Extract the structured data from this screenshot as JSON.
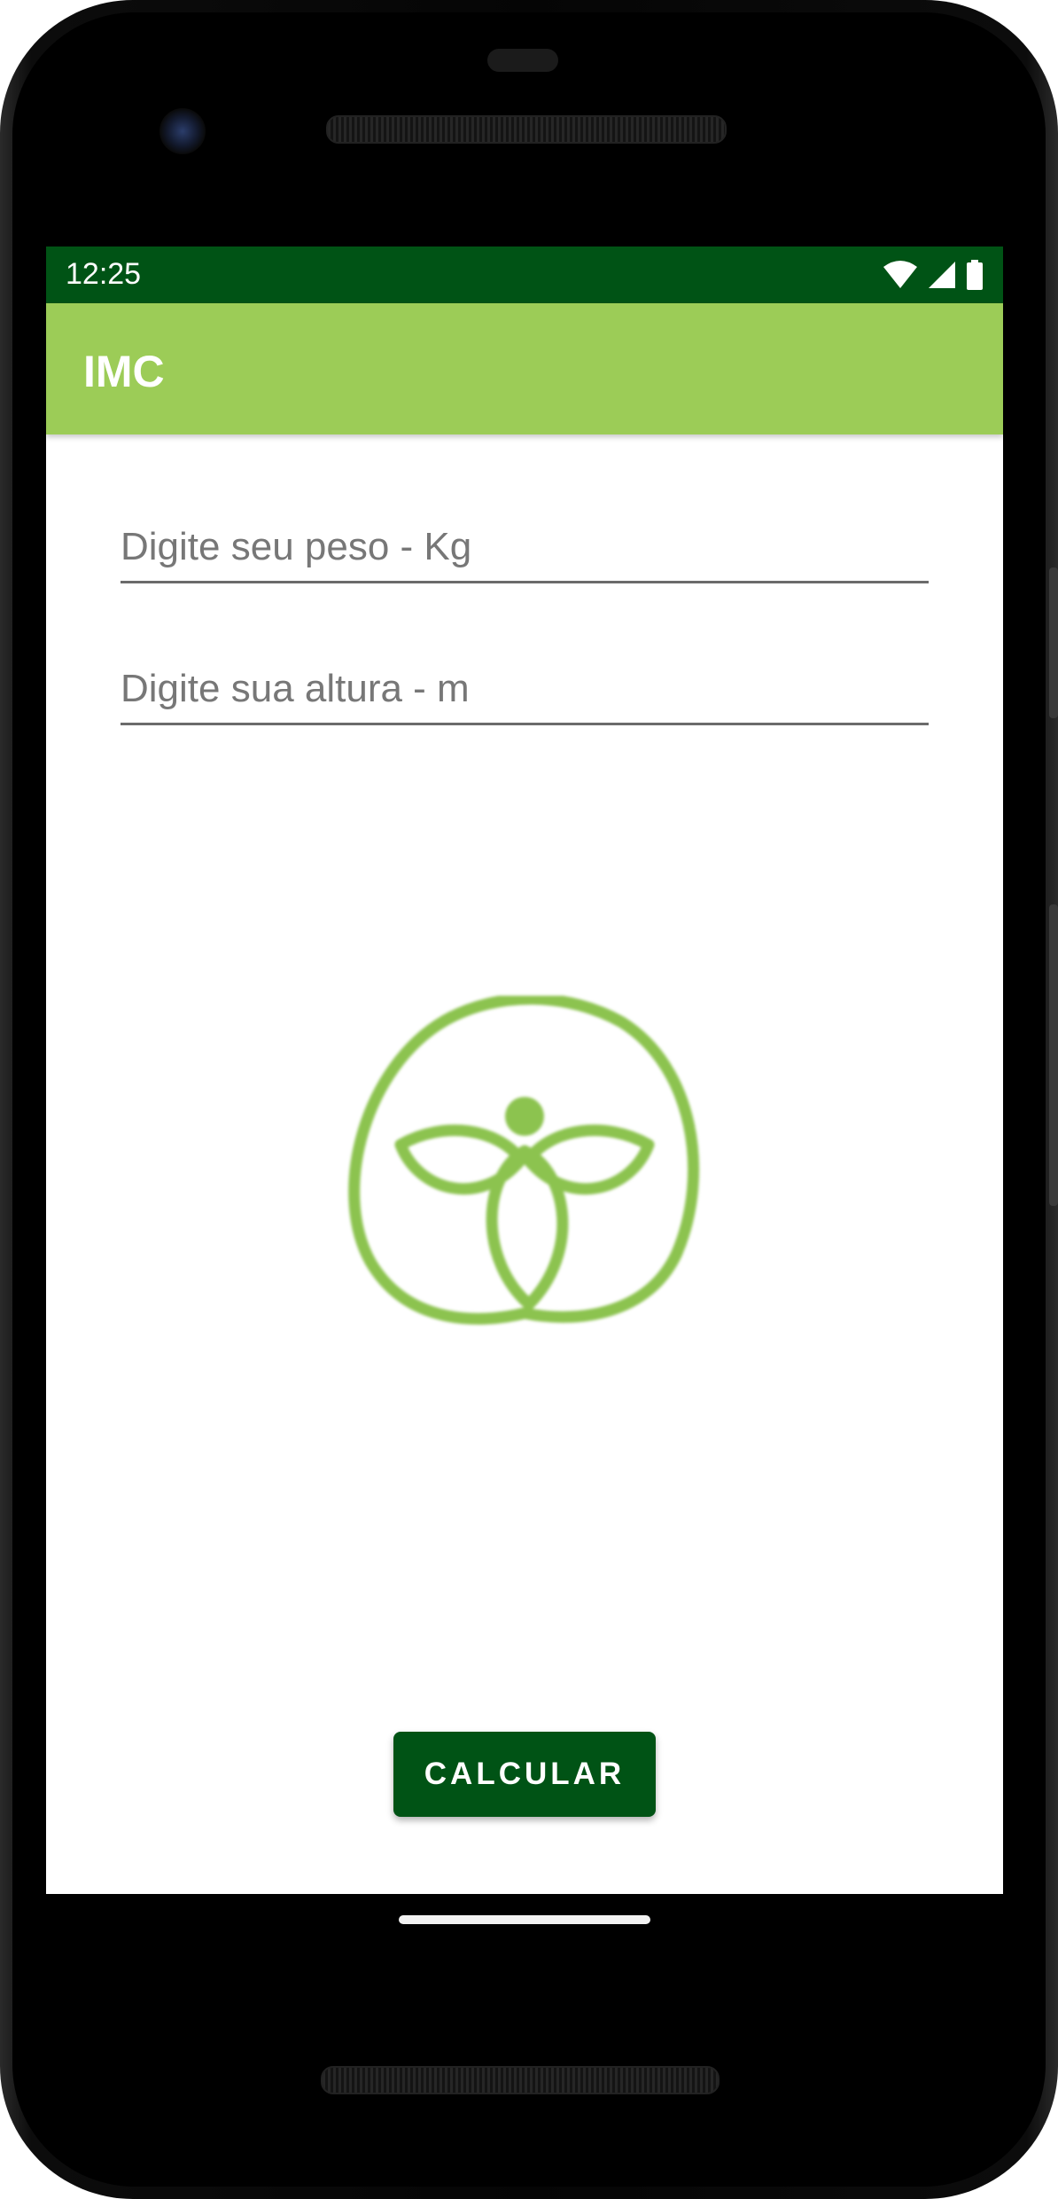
{
  "status_bar": {
    "time": "12:25",
    "background": "#005315",
    "icons": [
      "wifi-icon",
      "cell-signal-icon",
      "battery-icon"
    ]
  },
  "app_bar": {
    "title": "IMC",
    "background": "#9ccc57"
  },
  "form": {
    "weight_placeholder": "Digite seu peso - Kg",
    "weight_value": "",
    "height_placeholder": "Digite sua altura - m",
    "height_value": ""
  },
  "logo": {
    "icon": "wellness-figure-logo",
    "color": "#8cc34f"
  },
  "actions": {
    "calculate_label": "CALCULAR",
    "calculate_color": "#005315"
  }
}
